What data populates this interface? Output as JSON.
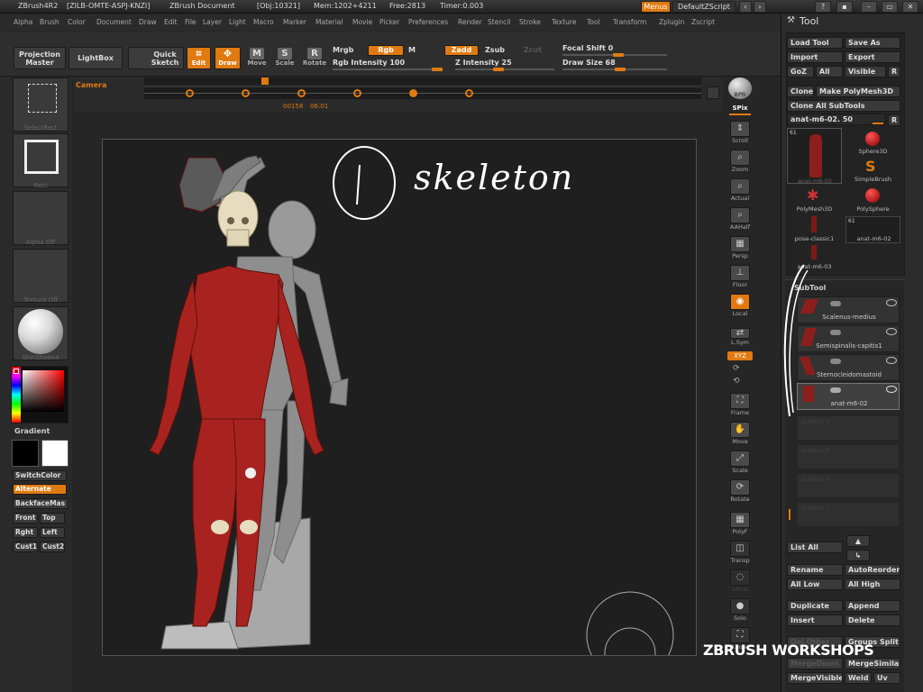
{
  "titlebar": {
    "app": "ZBrush4R2",
    "build": "[ZILB-OMTE-ASPJ-KNZI]",
    "doc": "ZBrush Document",
    "obj": "[Obj:10321]",
    "mem": "Mem:1202+4211",
    "free": "Free:2813",
    "timer": "Timer:0.003",
    "menus_btn": "Menus",
    "script": "DefaultZScript"
  },
  "menubar": [
    "Alpha",
    "Brush",
    "Color",
    "Document",
    "Draw",
    "Edit",
    "File",
    "Layer",
    "Light",
    "Macro",
    "Marker",
    "Material",
    "Movie",
    "Picker",
    "Preferences",
    "Render",
    "Stencil",
    "Stroke",
    "Texture",
    "Tool",
    "Transform",
    "Zplugin",
    "Zscript"
  ],
  "shelf": {
    "projection_master": "Projection Master",
    "lightbox": "LightBox",
    "quick_sketch": "Quick Sketch",
    "edit": "Edit",
    "draw": "Draw",
    "move": "Move",
    "scale": "Scale",
    "rotate": "Rotate",
    "move_key": "M",
    "scale_key": "S",
    "rotate_key": "R",
    "mrgb": "Mrgb",
    "rgb": "Rgb",
    "m": "M",
    "rgb_intensity": "Rgb Intensity 100",
    "zadd": "Zadd",
    "zsub": "Zsub",
    "zcut": "Zcut",
    "z_intensity": "Z Intensity 25",
    "focal_shift": "Focal Shift 0",
    "draw_size": "Draw Size 68"
  },
  "timeline": {
    "camera": "Camera",
    "time": "00158",
    "time2": "06:01"
  },
  "left": {
    "select_rect": "SelectRect",
    "rect": "Rect",
    "alpha_off": "Alpha Off",
    "texture_off": "Texture Off",
    "skin_shade": "SkinShade4",
    "gradient": "Gradient",
    "switch_color": "SwitchColor",
    "alternate": "Alternate",
    "backface": "BackfaceMas",
    "front": "Front",
    "top": "Top",
    "right": "Rght",
    "left": "Left",
    "cust1": "Cust1",
    "cust2": "Cust2"
  },
  "right_shelf": {
    "bpr": "BPR",
    "spix": "SPix",
    "scroll": "Scroll",
    "zoom": "Zoom",
    "actual": "Actual",
    "aahalf": "AAHalf",
    "persp": "Persp",
    "floor": "Floor",
    "local": "Local",
    "lsym": "L.Sym",
    "xyz": "XYZ",
    "frame": "Frame",
    "move": "Move",
    "scale": "Scale",
    "rotate": "Rotate",
    "polyf": "PolyF",
    "transp": "Transp",
    "ghost": "Ghost",
    "solo": "Solo",
    "xpose": "Xpose"
  },
  "tool": {
    "title": "Tool",
    "load_tool": "Load Tool",
    "save_as": "Save As",
    "import": "Import",
    "export": "Export",
    "goz": "GoZ",
    "all": "All",
    "visible": "Visible",
    "r": "R",
    "clone": "Clone",
    "make_polymesh": "Make PolyMesh3D",
    "clone_all": "Clone All SubTools",
    "current": "anat-m6-02. 50",
    "thumbs": {
      "t1": "anat-m6-02",
      "t2": "Sphere3D",
      "t3": "SimpleBrush",
      "t4": "PolyMesh3D",
      "t5": "PolySphere",
      "t6": "pose-classic1",
      "t7": "anat-m6-02",
      "t8": "anat-m6-03",
      "count1": "61",
      "count2": "61"
    },
    "subtool_header": "SubTool",
    "subtools": [
      "Scalenus-medius",
      "Semispinalis-capitis1",
      "Sternocleidomastoid",
      "anat-m6-02"
    ],
    "ghost_rows": [
      "Subtool 4",
      "Subtool 5",
      "Subtool 6",
      "Subtool 7"
    ],
    "list_all": "List All",
    "rename": "Rename",
    "autoreorder": "AutoReorder",
    "all_low": "All Low",
    "all_high": "All High",
    "duplicate": "Duplicate",
    "append": "Append",
    "insert": "Insert",
    "delete": "Delete",
    "del_other": "Del Other",
    "groups_split": "Groups Split",
    "merge_down": "MergeDown",
    "merge_similar": "MergeSimilar",
    "merge_visible": "MergeVisible",
    "weld": "Weld",
    "uv": "Uv"
  },
  "annotation": {
    "text": "skeleton"
  },
  "watermark": "ZBRUSH WORKSHOPS"
}
